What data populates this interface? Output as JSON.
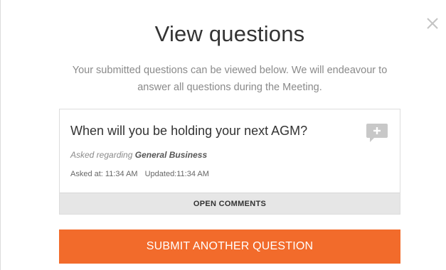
{
  "modal": {
    "title": "View questions",
    "subtitle": "Your submitted questions can be viewed below. We will endeavour to answer all questions during the Meeting.",
    "close_icon": "close-icon"
  },
  "question_card": {
    "question": "When will you be holding your next AGM?",
    "regarding_prefix": "Asked regarding ",
    "regarding_topic": "General Business",
    "asked_label": "Asked at: ",
    "asked_time": "11:34 AM",
    "updated_label": "Updated:",
    "updated_time": "11:34 AM",
    "comment_icon": "add-comment-icon",
    "open_comments_label": "OPEN COMMENTS"
  },
  "actions": {
    "submit_label": "SUBMIT ANOTHER QUESTION"
  },
  "colors": {
    "accent": "#f26b2b",
    "footer_bg": "#e6e6e6",
    "icon_grey": "#c8c8c8"
  }
}
